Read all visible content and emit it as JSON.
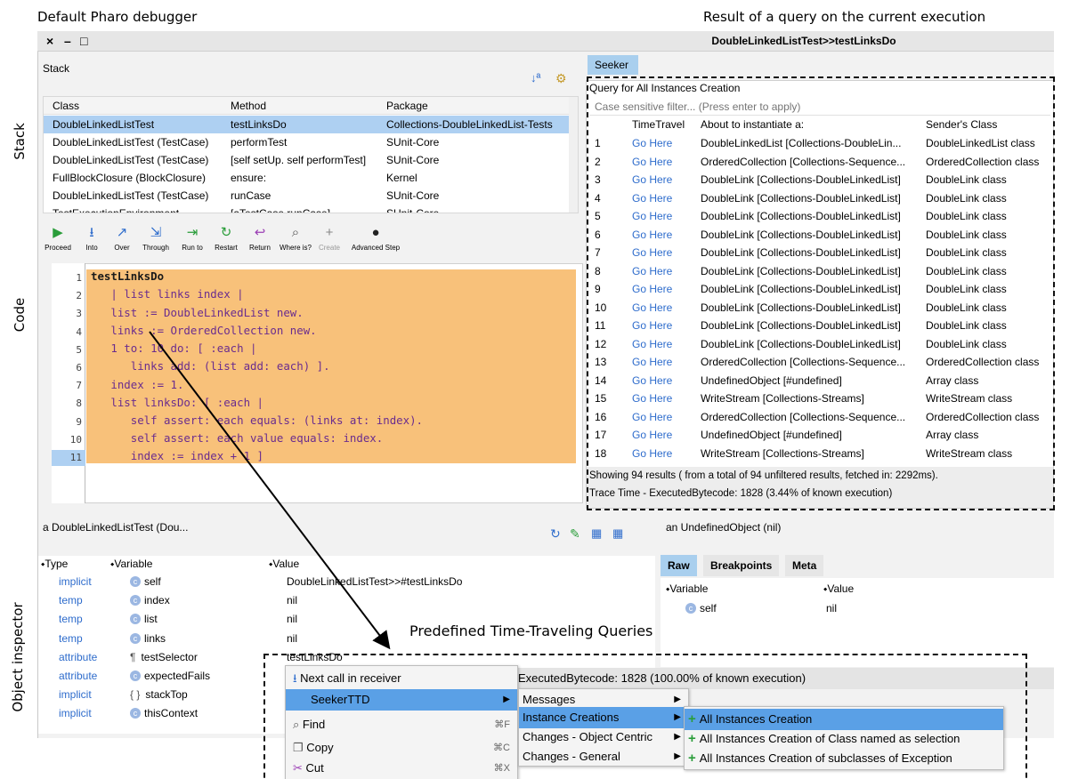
{
  "captions": {
    "left_top": "Default Pharo debugger",
    "right_top": "Result of a query on the current execution",
    "side_stack": "Stack",
    "side_code": "Code",
    "side_inspector": "Object inspector",
    "queries": "Predefined Time-Traveling Queries"
  },
  "window": {
    "title": "DoubleLinkedListTest>>testLinksDo",
    "controls": [
      "×",
      "–",
      "□"
    ]
  },
  "stack": {
    "title": "Stack",
    "columns": [
      "Class",
      "Method",
      "Package"
    ],
    "rows": [
      [
        "DoubleLinkedListTest",
        "testLinksDo",
        "Collections-DoubleLinkedList-Tests"
      ],
      [
        "DoubleLinkedListTest (TestCase)",
        "performTest",
        "SUnit-Core"
      ],
      [
        "DoubleLinkedListTest (TestCase)",
        "[self setUp. self performTest]",
        "SUnit-Core"
      ],
      [
        "FullBlockClosure (BlockClosure)",
        "ensure:",
        "Kernel"
      ],
      [
        "DoubleLinkedListTest (TestCase)",
        "runCase",
        "SUnit-Core"
      ],
      [
        "TestExecutionEnvironment",
        "[aTestCase runCase]",
        "SUnit-Core"
      ]
    ]
  },
  "toolbar": {
    "buttons": [
      {
        "label": "Proceed",
        "glyph": "▶",
        "color": "#2a9d3a"
      },
      {
        "label": "Into",
        "glyph": "⭳",
        "color": "#2e6ccc"
      },
      {
        "label": "Over",
        "glyph": "↗",
        "color": "#2e6ccc"
      },
      {
        "label": "Through",
        "glyph": "⇲",
        "color": "#2e6ccc"
      },
      {
        "label": "Run to",
        "glyph": "⇥",
        "color": "#2a9d3a"
      },
      {
        "label": "Restart",
        "glyph": "↻",
        "color": "#2a9d3a"
      },
      {
        "label": "Return",
        "glyph": "↩",
        "color": "#9b3fb5"
      },
      {
        "label": "Where is?",
        "glyph": "⌕",
        "color": "#555555"
      },
      {
        "label": "Create",
        "glyph": "+",
        "color": "#888888"
      },
      {
        "label": "Advanced Step",
        "glyph": "●",
        "color": "#222222"
      }
    ]
  },
  "code": {
    "lines": [
      "testLinksDo",
      "   | list links index |",
      "   list := DoubleLinkedList new.",
      "   links := OrderedCollection new.",
      "   1 to: 10 do: [ :each |",
      "      links add: (list add: each) ].",
      "   index := 1.",
      "   list linksDo: [ :each |",
      "      self assert: each equals: (links at: index).",
      "      self assert: each value equals: index.",
      "      index := index + 1 ]"
    ],
    "line_numbers": [
      "1",
      "2",
      "3",
      "4",
      "5",
      "6",
      "7",
      "8",
      "9",
      "10",
      "11"
    ]
  },
  "seeker": {
    "tab": "Seeker",
    "query_title": "Query for All Instances Creation",
    "filter_placeholder": "Case sensitive filter... (Press enter to apply)",
    "columns": [
      "",
      "TimeTravel",
      "About to instantiate a:",
      "Sender's Class"
    ],
    "rows": [
      [
        "1",
        "Go Here",
        "DoubleLinkedList [Collections-DoubleLin...",
        "DoubleLinkedList class"
      ],
      [
        "2",
        "Go Here",
        "OrderedCollection [Collections-Sequence...",
        "OrderedCollection class"
      ],
      [
        "3",
        "Go Here",
        "DoubleLink [Collections-DoubleLinkedList]",
        "DoubleLink class"
      ],
      [
        "4",
        "Go Here",
        "DoubleLink [Collections-DoubleLinkedList]",
        "DoubleLink class"
      ],
      [
        "5",
        "Go Here",
        "DoubleLink [Collections-DoubleLinkedList]",
        "DoubleLink class"
      ],
      [
        "6",
        "Go Here",
        "DoubleLink [Collections-DoubleLinkedList]",
        "DoubleLink class"
      ],
      [
        "7",
        "Go Here",
        "DoubleLink [Collections-DoubleLinkedList]",
        "DoubleLink class"
      ],
      [
        "8",
        "Go Here",
        "DoubleLink [Collections-DoubleLinkedList]",
        "DoubleLink class"
      ],
      [
        "9",
        "Go Here",
        "DoubleLink [Collections-DoubleLinkedList]",
        "DoubleLink class"
      ],
      [
        "10",
        "Go Here",
        "DoubleLink [Collections-DoubleLinkedList]",
        "DoubleLink class"
      ],
      [
        "11",
        "Go Here",
        "DoubleLink [Collections-DoubleLinkedList]",
        "DoubleLink class"
      ],
      [
        "12",
        "Go Here",
        "DoubleLink [Collections-DoubleLinkedList]",
        "DoubleLink class"
      ],
      [
        "13",
        "Go Here",
        "OrderedCollection [Collections-Sequence...",
        "OrderedCollection class"
      ],
      [
        "14",
        "Go Here",
        "UndefinedObject [#undefined]",
        "Array class"
      ],
      [
        "15",
        "Go Here",
        "WriteStream [Collections-Streams]",
        "WriteStream class"
      ],
      [
        "16",
        "Go Here",
        "OrderedCollection [Collections-Sequence...",
        "OrderedCollection class"
      ],
      [
        "17",
        "Go Here",
        "UndefinedObject [#undefined]",
        "Array class"
      ],
      [
        "18",
        "Go Here",
        "WriteStream [Collections-Streams]",
        "WriteStream class"
      ]
    ],
    "footer_results": "Showing 94 results ( from a total of 94 unfiltered results, fetched in: 2292ms).",
    "footer_trace": "Trace Time - ExecutedBytecode: 1828 (3.44% of known execution)"
  },
  "inspector_left": {
    "title": "a DoubleLinkedListTest (Dou...",
    "columns": [
      "Type",
      "Variable",
      "Value"
    ],
    "rows": [
      {
        "type": "implicit",
        "icon": "c",
        "variable": "self",
        "value": "DoubleLinkedListTest>>#testLinksDo"
      },
      {
        "type": "temp",
        "icon": "c",
        "variable": "index",
        "value": "nil"
      },
      {
        "type": "temp",
        "icon": "c",
        "variable": "list",
        "value": "nil"
      },
      {
        "type": "temp",
        "icon": "c",
        "variable": "links",
        "value": "nil"
      },
      {
        "type": "attribute",
        "icon": "¶",
        "variable": "testSelector",
        "value": "testLinksDo"
      },
      {
        "type": "attribute",
        "icon": "c",
        "variable": "expectedFails",
        "value": ""
      },
      {
        "type": "implicit",
        "icon": "{ }",
        "variable": "stackTop",
        "value": ""
      },
      {
        "type": "implicit",
        "icon": "c",
        "variable": "thisContext",
        "value": ""
      }
    ]
  },
  "inspector_right": {
    "title": "an UndefinedObject (nil)",
    "tabs": [
      "Raw",
      "Breakpoints",
      "Meta"
    ],
    "columns": [
      "Variable",
      "Value"
    ],
    "rows": [
      {
        "variable": "self",
        "value": "nil"
      }
    ],
    "exec_bar": "ExecutedBytecode: 1828 (100.00% of known execution)"
  },
  "context_menu": {
    "items": [
      {
        "label": "Next call in receiver",
        "shortcut": "",
        "submenu": false
      },
      {
        "label": "SeekerTTD",
        "shortcut": "",
        "submenu": true
      },
      {
        "label": "Find",
        "shortcut": "⌘F",
        "submenu": false
      },
      {
        "label": "Copy",
        "shortcut": "⌘C",
        "submenu": false
      },
      {
        "label": "Cut",
        "shortcut": "⌘X",
        "submenu": false
      }
    ]
  },
  "seeker_menu": {
    "items": [
      "Messages",
      "Instance Creations",
      "Changes - Object Centric",
      "Changes - General"
    ]
  },
  "instance_menu": {
    "items": [
      "All Instances Creation",
      "All Instances Creation of Class named as selection",
      "All Instances Creation of subclasses of Exception"
    ]
  },
  "colors": {
    "selection_blue": "#aed0f2",
    "menu_highlight": "#5aa0e6",
    "code_highlight": "#f8c17a",
    "link_blue": "#2e6ccc"
  }
}
